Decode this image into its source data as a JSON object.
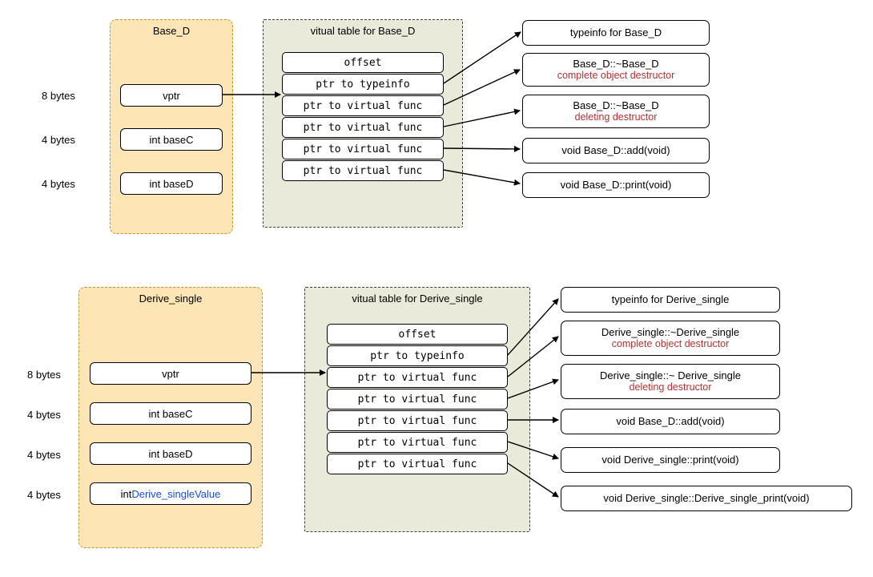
{
  "top": {
    "class_name": "Base_D",
    "bytes": [
      "8 bytes",
      "4 bytes",
      "4 bytes"
    ],
    "fields": [
      "vptr",
      "int baseC",
      "int baseD"
    ],
    "vtable_title": "vitual table for Base_D",
    "vrows": [
      "offset",
      "ptr to typeinfo",
      "ptr to virtual func",
      "ptr to virtual func",
      "ptr to virtual func",
      "ptr to virtual func"
    ],
    "targets": {
      "t0": {
        "line1": "typeinfo for Base_D"
      },
      "t1": {
        "line1": "Base_D::~Base_D",
        "line2": "complete object destructor"
      },
      "t2": {
        "line1": "Base_D::~Base_D",
        "line2": "deleting destructor"
      },
      "t3": {
        "line1": "void Base_D::add(void)"
      },
      "t4": {
        "line1": "void Base_D::print(void)"
      }
    }
  },
  "bottom": {
    "class_name": "Derive_single",
    "bytes": [
      "8 bytes",
      "4 bytes",
      "4 bytes",
      "4 bytes"
    ],
    "fields_plain": [
      "vptr",
      "int baseC",
      "int baseD"
    ],
    "field_mixed_prefix": "int ",
    "field_mixed_blue": "Derive_singleValue",
    "vtable_title": "vitual table for Derive_single",
    "vrows": [
      "offset",
      "ptr to typeinfo",
      "ptr to virtual func",
      "ptr to virtual func",
      "ptr to virtual func",
      "ptr to virtual func",
      "ptr to virtual func"
    ],
    "targets": {
      "t0": {
        "line1": "typeinfo for Derive_single"
      },
      "t1": {
        "line1": "Derive_single::~Derive_single",
        "line2": "complete object destructor"
      },
      "t2": {
        "line1": "Derive_single::~ Derive_single",
        "line2": "deleting destructor"
      },
      "t3": {
        "line1": "void Base_D::add(void)"
      },
      "t4": {
        "line1": "void Derive_single::print(void)"
      },
      "t5": {
        "line1": "void Derive_single::Derive_single_print(void)"
      }
    }
  }
}
